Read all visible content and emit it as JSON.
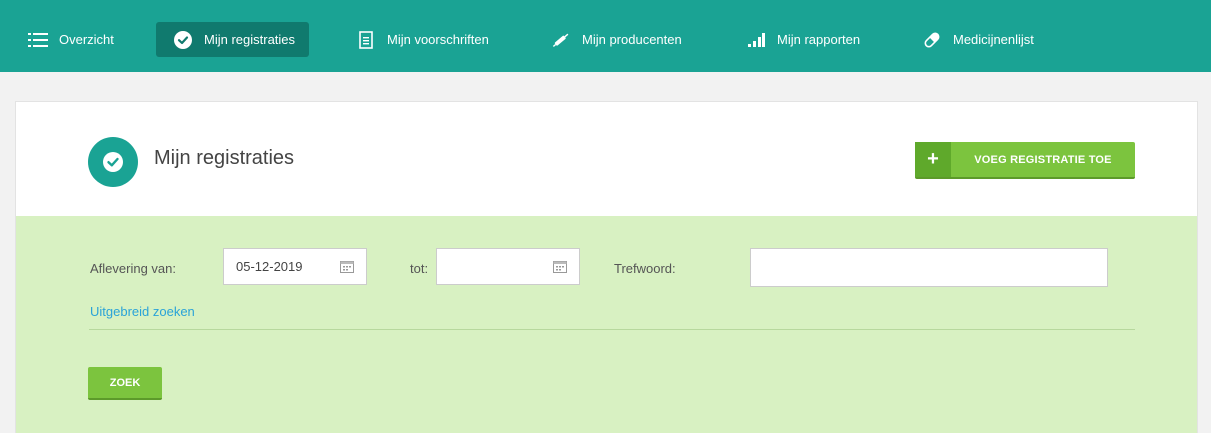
{
  "nav": {
    "items": [
      {
        "label": "Overzicht",
        "icon": "list-icon"
      },
      {
        "label": "Mijn registraties",
        "icon": "check-circle-icon",
        "active": true
      },
      {
        "label": "Mijn voorschriften",
        "icon": "document-icon"
      },
      {
        "label": "Mijn producenten",
        "icon": "syringe-icon"
      },
      {
        "label": "Mijn rapporten",
        "icon": "bar-chart-icon"
      },
      {
        "label": "Medicijnenlijst",
        "icon": "pill-icon"
      }
    ]
  },
  "header": {
    "title": "Mijn registraties",
    "add_button": "VOEG REGISTRATIE TOE"
  },
  "search": {
    "from_label": "Aflevering van:",
    "from_value": "05-12-2019",
    "to_label": "tot:",
    "to_value": "",
    "keyword_label": "Trefwoord:",
    "keyword_value": "",
    "advanced_link": "Uitgebreid zoeken",
    "submit": "ZOEK"
  },
  "colors": {
    "nav_bg": "#1aa394",
    "nav_active": "#107a6e",
    "accent_green": "#7cc43e",
    "search_bg": "#d8f1c2",
    "link": "#2aa3d8"
  }
}
